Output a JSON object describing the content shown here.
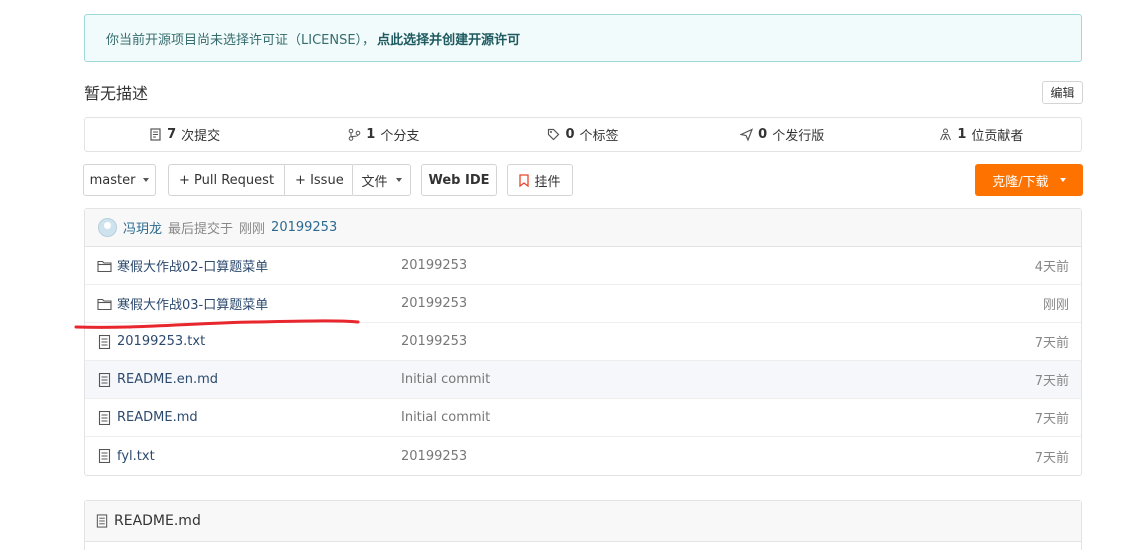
{
  "license": {
    "text": "你当前开源项目尚未选择许可证（LICENSE），",
    "link": "点此选择并创建开源许可"
  },
  "description": "暂无描述",
  "edit_label": "编辑",
  "stats": [
    {
      "icon": "commit-icon",
      "count": "7",
      "label": "次提交"
    },
    {
      "icon": "branch-icon",
      "count": "1",
      "label": "个分支"
    },
    {
      "icon": "tag-icon",
      "count": "0",
      "label": "个标签"
    },
    {
      "icon": "release-icon",
      "count": "0",
      "label": "个发行版"
    },
    {
      "icon": "contributors-icon",
      "count": "1",
      "label": "位贡献者"
    }
  ],
  "toolbar": {
    "branch": "master",
    "pull_request": "+ Pull Request",
    "issue": "+ Issue",
    "file_menu": "文件",
    "web_ide": "Web IDE",
    "widget": "挂件",
    "clone": "克隆/下载"
  },
  "commit": {
    "author": "冯玥龙",
    "meta": "最后提交于",
    "time": "刚刚",
    "hash": "20199253"
  },
  "files": [
    {
      "type": "folder",
      "name": "寒假大作战02-口算题菜单",
      "message": "20199253",
      "time": "4天前"
    },
    {
      "type": "folder",
      "name": "寒假大作战03-口算题菜单",
      "message": "20199253",
      "time": "刚刚"
    },
    {
      "type": "file",
      "name": "20199253.txt",
      "message": "20199253",
      "time": "7天前"
    },
    {
      "type": "file",
      "name": "README.en.md",
      "message": "Initial commit",
      "time": "7天前"
    },
    {
      "type": "file",
      "name": "README.md",
      "message": "Initial commit",
      "time": "7天前"
    },
    {
      "type": "file",
      "name": "fyl.txt",
      "message": "20199253",
      "time": "7天前"
    }
  ],
  "readme_title": "README.md",
  "colors": {
    "accent": "#fe7300",
    "annotation": "#e8262d",
    "link": "#2c4a6e"
  }
}
